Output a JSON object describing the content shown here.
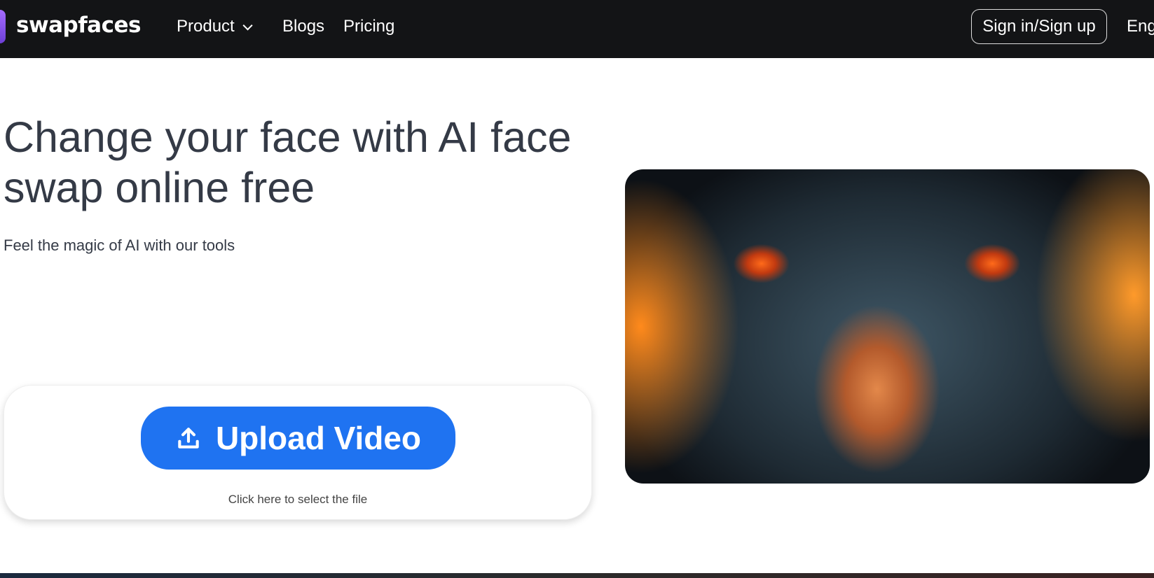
{
  "nav": {
    "logo": "swapfaces",
    "product": "Product",
    "blogs": "Blogs",
    "pricing": "Pricing",
    "signin": "Sign in/Sign up",
    "language": "Eng"
  },
  "hero": {
    "title": "Change your face with AI face swap online free",
    "subtitle": "Feel the magic of AI with our tools"
  },
  "upload": {
    "button": "Upload Video",
    "caption": "Click here to select the file"
  },
  "colors": {
    "nav_bg": "#131416",
    "primary": "#1f73f1",
    "text": "#343a46"
  }
}
